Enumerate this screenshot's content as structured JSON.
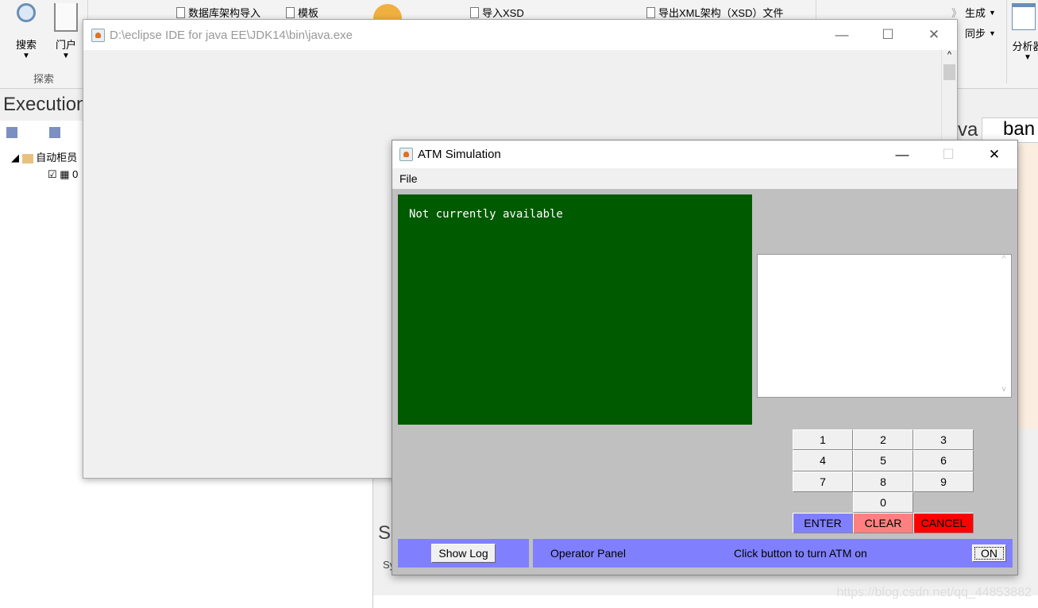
{
  "ribbon": {
    "search": "搜索",
    "portal": "门户",
    "explore_group": "探索",
    "db_import": "数据库架构导入",
    "template": "模板",
    "import_xsd": "导入XSD",
    "export_xsd": "导出XML架构（XSD）文件",
    "generate": "生成",
    "sync": "同步",
    "analyze": "分析器"
  },
  "left_panel": {
    "title": "Execution",
    "tree_root": "自动柜员",
    "tree_child": "0"
  },
  "right_tab": {
    "partial": "va",
    "tab": "ban"
  },
  "bottom_panel": {
    "title_partial": "S",
    "sub_partial": "Sy"
  },
  "bg_window": {
    "title": "D:\\eclipse IDE for java EE\\JDK14\\bin\\java.exe"
  },
  "atm": {
    "title": "ATM Simulation",
    "menu": [
      "File"
    ],
    "screen_text": "Not currently available",
    "keys": [
      "1",
      "2",
      "3",
      "4",
      "5",
      "6",
      "7",
      "8",
      "9",
      "0"
    ],
    "enter": "ENTER",
    "clear": "CLEAR",
    "cancel": "CANCEL",
    "show_log": "Show Log",
    "operator_panel": "Operator Panel",
    "status": "Click button to turn ATM on",
    "on": "ON",
    "colors": {
      "screen": "#005a00",
      "panel": "#c0c0c0",
      "bar": "#8080ff",
      "enter": "#8080ff",
      "clear": "#ff8080",
      "cancel": "#ff0000"
    }
  },
  "watermark": "https://blog.csdn.net/qq_44853882"
}
